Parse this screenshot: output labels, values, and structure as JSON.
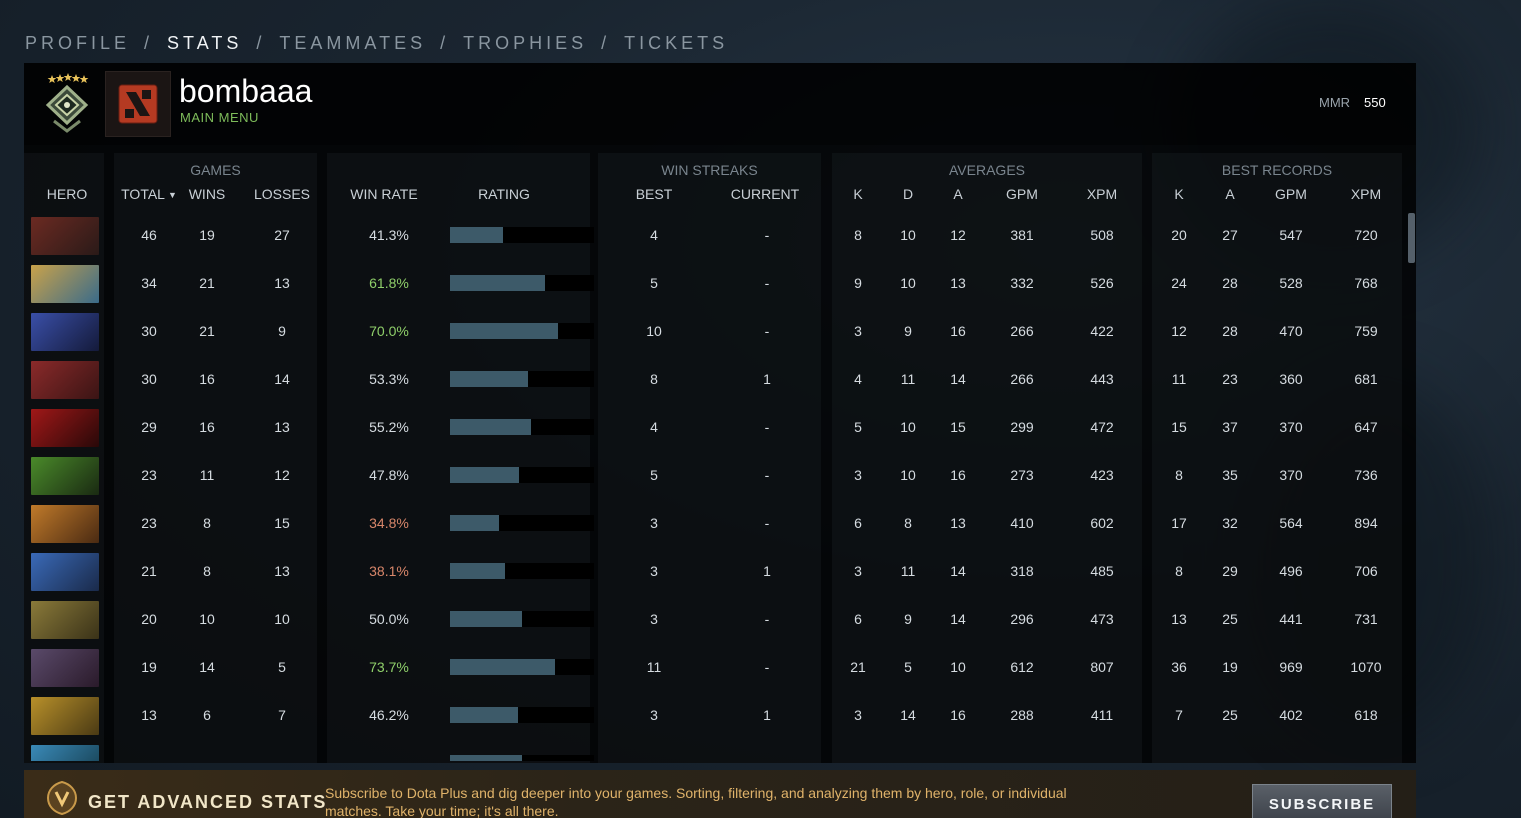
{
  "nav": {
    "items": [
      {
        "label": "PROFILE",
        "active": false
      },
      {
        "label": "STATS",
        "active": true
      },
      {
        "label": "TEAMMATES",
        "active": false
      },
      {
        "label": "TROPHIES",
        "active": false
      },
      {
        "label": "TICKETS",
        "active": false
      }
    ],
    "separator": "/"
  },
  "profile": {
    "name": "bombaaa",
    "status": "MAIN MENU",
    "mmr_label": "MMR",
    "mmr_value": "550"
  },
  "table": {
    "groups": {
      "games": "GAMES",
      "win_streaks": "WIN STREAKS",
      "averages": "AVERAGES",
      "best_records": "BEST RECORDS"
    },
    "columns": {
      "hero": "HERO",
      "total": "TOTAL",
      "wins": "WINS",
      "losses": "LOSSES",
      "win_rate": "WIN RATE",
      "rating": "RATING",
      "streak_best": "BEST",
      "streak_current": "CURRENT",
      "avg_k": "K",
      "avg_d": "D",
      "avg_a": "A",
      "avg_gpm": "GPM",
      "avg_xpm": "XPM",
      "best_k": "K",
      "best_a": "A",
      "best_gpm": "GPM",
      "best_xpm": "XPM"
    },
    "rows": [
      {
        "total": "46",
        "wins": "19",
        "losses": "27",
        "win_rate": "41.3%",
        "rating": 0.37,
        "streak_best": "4",
        "streak_current": "-",
        "avg_k": "8",
        "avg_d": "10",
        "avg_a": "12",
        "avg_gpm": "381",
        "avg_xpm": "508",
        "best_k": "20",
        "best_a": "27",
        "best_gpm": "547",
        "best_xpm": "720",
        "tone": "neutral",
        "c1": "#6b2a22",
        "c2": "#2a1a18"
      },
      {
        "total": "34",
        "wins": "21",
        "losses": "13",
        "win_rate": "61.8%",
        "rating": 0.66,
        "streak_best": "5",
        "streak_current": "-",
        "avg_k": "9",
        "avg_d": "10",
        "avg_a": "13",
        "avg_gpm": "332",
        "avg_xpm": "526",
        "best_k": "24",
        "best_a": "28",
        "best_gpm": "528",
        "best_xpm": "768",
        "tone": "good",
        "c1": "#c9a24a",
        "c2": "#3a6b8a"
      },
      {
        "total": "30",
        "wins": "21",
        "losses": "9",
        "win_rate": "70.0%",
        "rating": 0.75,
        "streak_best": "10",
        "streak_current": "-",
        "avg_k": "3",
        "avg_d": "9",
        "avg_a": "16",
        "avg_gpm": "266",
        "avg_xpm": "422",
        "best_k": "12",
        "best_a": "28",
        "best_gpm": "470",
        "best_xpm": "759",
        "tone": "good",
        "c1": "#3a4fa8",
        "c2": "#141a3a"
      },
      {
        "total": "30",
        "wins": "16",
        "losses": "14",
        "win_rate": "53.3%",
        "rating": 0.54,
        "streak_best": "8",
        "streak_current": "1",
        "avg_k": "4",
        "avg_d": "11",
        "avg_a": "14",
        "avg_gpm": "266",
        "avg_xpm": "443",
        "best_k": "11",
        "best_a": "23",
        "best_gpm": "360",
        "best_xpm": "681",
        "tone": "neutral",
        "c1": "#8a2a2a",
        "c2": "#3a1414"
      },
      {
        "total": "29",
        "wins": "16",
        "losses": "13",
        "win_rate": "55.2%",
        "rating": 0.56,
        "streak_best": "4",
        "streak_current": "-",
        "avg_k": "5",
        "avg_d": "10",
        "avg_a": "15",
        "avg_gpm": "299",
        "avg_xpm": "472",
        "best_k": "15",
        "best_a": "37",
        "best_gpm": "370",
        "best_xpm": "647",
        "tone": "neutral",
        "c1": "#a01818",
        "c2": "#280808"
      },
      {
        "total": "23",
        "wins": "11",
        "losses": "12",
        "win_rate": "47.8%",
        "rating": 0.48,
        "streak_best": "5",
        "streak_current": "-",
        "avg_k": "3",
        "avg_d": "10",
        "avg_a": "16",
        "avg_gpm": "273",
        "avg_xpm": "423",
        "best_k": "8",
        "best_a": "35",
        "best_gpm": "370",
        "best_xpm": "736",
        "tone": "neutral",
        "c1": "#4a8a2a",
        "c2": "#1a2a12"
      },
      {
        "total": "23",
        "wins": "8",
        "losses": "15",
        "win_rate": "34.8%",
        "rating": 0.34,
        "streak_best": "3",
        "streak_current": "-",
        "avg_k": "6",
        "avg_d": "8",
        "avg_a": "13",
        "avg_gpm": "410",
        "avg_xpm": "602",
        "best_k": "17",
        "best_a": "32",
        "best_gpm": "564",
        "best_xpm": "894",
        "tone": "bad",
        "c1": "#c07a2a",
        "c2": "#4a2a12"
      },
      {
        "total": "21",
        "wins": "8",
        "losses": "13",
        "win_rate": "38.1%",
        "rating": 0.38,
        "streak_best": "3",
        "streak_current": "1",
        "avg_k": "3",
        "avg_d": "11",
        "avg_a": "14",
        "avg_gpm": "318",
        "avg_xpm": "485",
        "best_k": "8",
        "best_a": "29",
        "best_gpm": "496",
        "best_xpm": "706",
        "tone": "bad",
        "c1": "#3a6ab8",
        "c2": "#1a2a4a"
      },
      {
        "total": "20",
        "wins": "10",
        "losses": "10",
        "win_rate": "50.0%",
        "rating": 0.5,
        "streak_best": "3",
        "streak_current": "-",
        "avg_k": "6",
        "avg_d": "9",
        "avg_a": "14",
        "avg_gpm": "296",
        "avg_xpm": "473",
        "best_k": "13",
        "best_a": "25",
        "best_gpm": "441",
        "best_xpm": "731",
        "tone": "neutral",
        "c1": "#8a7a3a",
        "c2": "#3a3218"
      },
      {
        "total": "19",
        "wins": "14",
        "losses": "5",
        "win_rate": "73.7%",
        "rating": 0.73,
        "streak_best": "11",
        "streak_current": "-",
        "avg_k": "21",
        "avg_d": "5",
        "avg_a": "10",
        "avg_gpm": "612",
        "avg_xpm": "807",
        "best_k": "36",
        "best_a": "19",
        "best_gpm": "969",
        "best_xpm": "1070",
        "tone": "good",
        "c1": "#5a4a6a",
        "c2": "#2a1a2a"
      },
      {
        "total": "13",
        "wins": "6",
        "losses": "7",
        "win_rate": "46.2%",
        "rating": 0.47,
        "streak_best": "3",
        "streak_current": "1",
        "avg_k": "3",
        "avg_d": "14",
        "avg_a": "16",
        "avg_gpm": "288",
        "avg_xpm": "411",
        "best_k": "7",
        "best_a": "25",
        "best_gpm": "402",
        "best_xpm": "618",
        "tone": "neutral",
        "c1": "#b8902a",
        "c2": "#4a3a14"
      },
      {
        "total": "",
        "wins": "",
        "losses": "",
        "win_rate": "",
        "rating": 0.5,
        "streak_best": "",
        "streak_current": "",
        "avg_k": "",
        "avg_d": "",
        "avg_a": "",
        "avg_gpm": "",
        "avg_xpm": "",
        "best_k": "",
        "best_a": "",
        "best_gpm": "",
        "best_xpm": "",
        "tone": "neutral",
        "c1": "#3a8ab8",
        "c2": "#143a4a"
      }
    ]
  },
  "promo": {
    "title": "GET ADVANCED STATS",
    "text": "Subscribe to Dota Plus and dig deeper into your games. Sorting, filtering, and analyzing them by hero, role, or individual matches. Take your time; it's all there.",
    "button": "SUBSCRIBE"
  },
  "colors": {
    "win_rate_good": "#8fcf6a",
    "win_rate_bad": "#d8866a",
    "rating_bar": "#3d5a69",
    "status_green": "#7dbb5a"
  }
}
